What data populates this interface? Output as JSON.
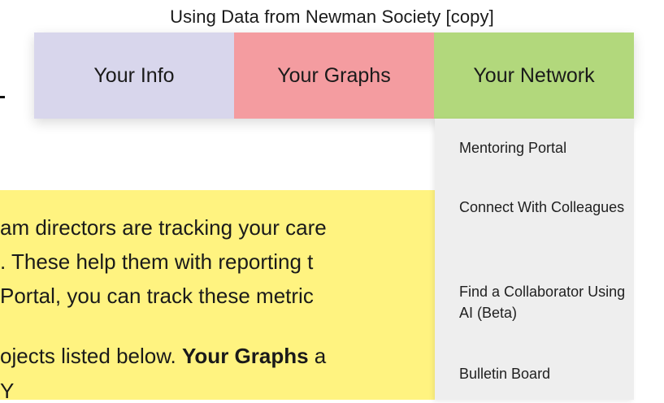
{
  "header": {
    "title": "Using Data from Newman Society [copy]"
  },
  "tabs": [
    {
      "label": "Your Info",
      "color": "#d8d6ec"
    },
    {
      "label": "Your Graphs",
      "color": "#f49ca0"
    },
    {
      "label": "Your Network",
      "color": "#b2d87c"
    }
  ],
  "dropdown": {
    "items": [
      {
        "label": "Mentoring Portal"
      },
      {
        "label": "Connect With Colleagues"
      },
      {
        "label": "Find a Collaborator Using AI (Beta)"
      },
      {
        "label": "Bulletin Board"
      }
    ]
  },
  "content": {
    "line1": "am directors are tracking your care",
    "line2": ". These help them with reporting t",
    "line3": " Portal, you can track these metric",
    "line4_a": "ojects listed below. ",
    "line4_b": "Your Graphs",
    "line4_c": " a",
    "line5": "  Y"
  }
}
